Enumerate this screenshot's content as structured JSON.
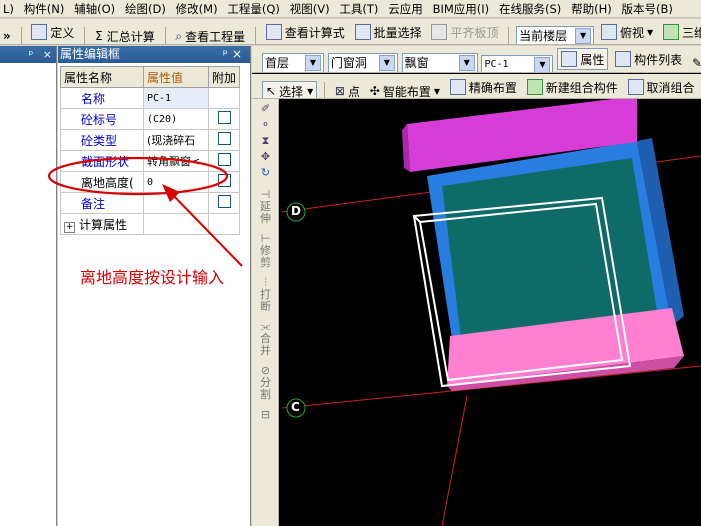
{
  "menu": [
    "L)",
    "构件(N)",
    "辅轴(O)",
    "绘图(D)",
    "修改(M)",
    "工程量(Q)",
    "视图(V)",
    "工具(T)",
    "云应用",
    "BIM应用(I)",
    "在线服务(S)",
    "帮助(H)",
    "版本号(B)"
  ],
  "toolbar": {
    "define": "定义",
    "summary": "汇总计算",
    "view_quantity": "查看工程量",
    "view_formula": "查看计算式",
    "batch_select": "批量选择",
    "flat_slab_top": "平齐板顶",
    "floor_scope": "当前楼层",
    "view_mode": "俯视",
    "three_d": "三维"
  },
  "left_panel": {
    "pin": "ᵖ",
    "close": "×"
  },
  "property_panel": {
    "title": "属性编辑框",
    "pin": "ᵖ",
    "close": "×",
    "columns": [
      "属性名称",
      "属性值",
      "附加"
    ],
    "rows": [
      {
        "name": "名称",
        "value": "PC-1",
        "checkbox": false
      },
      {
        "name": "砼标号",
        "value": "(C20)",
        "checkbox": true
      },
      {
        "name": "砼类型",
        "value": "(现浇碎石",
        "checkbox": true
      },
      {
        "name": "截面形状",
        "value": "转角飘窗<",
        "checkbox": true
      },
      {
        "name": "离地高度(",
        "value": "0",
        "checkbox": true
      },
      {
        "name": "备注",
        "value": "",
        "checkbox": true
      }
    ],
    "group_row": "计算属性"
  },
  "toolbar2": {
    "floor": "首层",
    "category": "门窗洞",
    "component_type": "飘窗",
    "component": "PC-1",
    "properties": "属性",
    "component_list": "构件列表",
    "extract": "拾"
  },
  "toolbar3": {
    "select": "选择",
    "point": "点",
    "smart_layout": "智能布置",
    "precise_layout": "精确布置",
    "new_combo": "新建组合构件",
    "cancel_combo": "取消组合"
  },
  "vertical_tools": [
    "延伸",
    "修剪",
    "打断",
    "合并",
    "分割"
  ],
  "axis_labels": [
    "D",
    "C"
  ],
  "annotation": "离地高度按设计输入",
  "colors": {
    "magenta_top": "#d63dd6",
    "pink_bottom": "#ff7fd0",
    "teal_glass": "#0e6b68",
    "blue_frame": "#2a7de0",
    "axis_red": "#cc2222",
    "annotation_red": "#d80000"
  }
}
